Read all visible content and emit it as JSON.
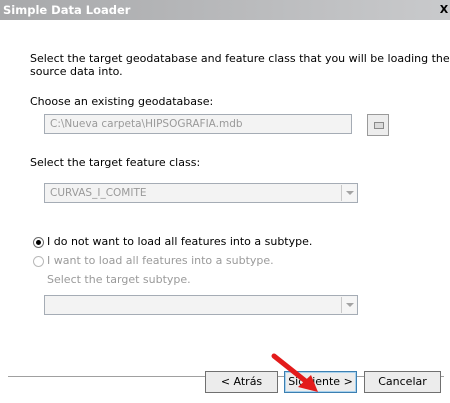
{
  "window": {
    "title": "Simple Data Loader",
    "close_glyph": "X"
  },
  "instructions": {
    "line1": "Select the target geodatabase and feature class that you will be loading the",
    "line2": "source data into."
  },
  "geodatabase": {
    "label": "Choose an existing geodatabase:",
    "value": "C:\\Nueva carpeta\\HIPSOGRAFIA.mdb",
    "browse_icon": "open-folder-icon"
  },
  "feature_class": {
    "label": "Select the target feature class:",
    "value": "CURVAS_I_COMITE"
  },
  "subtype": {
    "option_no": "I do not want to load all features into a subtype.",
    "option_yes": "I want to load all features into a subtype.",
    "select_label": "Select the target subtype.",
    "value": ""
  },
  "buttons": {
    "back": "< Atrás",
    "next": "Siguiente >",
    "cancel": "Cancelar"
  },
  "annotation": {
    "color": "#e31b1b",
    "icon": "red-pointer-arrow"
  }
}
